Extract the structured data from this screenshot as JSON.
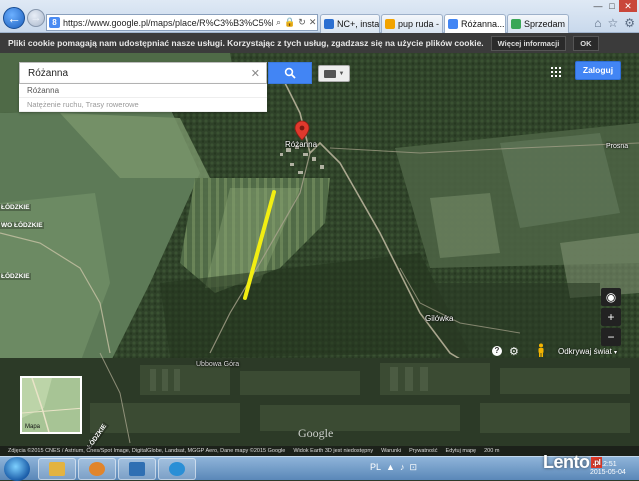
{
  "browser": {
    "address": "https://www.google.pl/maps/place/R%C3%B3%C5%BCanna/@5",
    "tabs": [
      {
        "label": "NC+, instal...",
        "icon_color": "#2c6fd1"
      },
      {
        "label": "pup ruda - ...",
        "icon_color": "#f2a300"
      },
      {
        "label": "Różanna...",
        "icon_color": "#4285f4"
      },
      {
        "label": "Sprzedam ...",
        "icon_color": "#3aa757"
      }
    ]
  },
  "cookie_bar": {
    "text": "Pliki cookie pomagają nam udostępniać nasze usługi. Korzystając z tych usług, zgadzasz się na użycie plików cookie.",
    "more_info": "Więcej informacji",
    "ok": "OK"
  },
  "search": {
    "value": "Różanna",
    "dropdown": [
      "Różanna",
      "Natężenie ruchu, Trasy rowerowe"
    ]
  },
  "header": {
    "signin": "Zaloguj"
  },
  "map": {
    "labels": {
      "town": "Różanna",
      "east": "Prosna",
      "village": "Gilówka",
      "south": "Ubbowa Góra",
      "road_left_1": "ŁÓDZKIE",
      "road_left_2": "WO ŁÓDZKIE",
      "road_left_3": "ŁÓDZKIE",
      "road_bottom": "ŁÓDZKIE"
    },
    "minimap_label": "Mapa",
    "google_logo": "Google",
    "explore_label": "Odkrywaj świat",
    "attribution": [
      "Zdjęcia ©2015 CNES / Astrium, Cnes/Spot Image, DigitalGlobe, Landsat, MGGP Aero, Dane mapy ©2015 Google",
      "Widok Earth 3D jest niedostępny",
      "Warunki",
      "Prywatność",
      "Edytuj mapę",
      "200 m"
    ]
  },
  "taskbar": {
    "apps": [
      {
        "icon_color": "#e3b341"
      },
      {
        "icon_color": "#e1852c"
      },
      {
        "icon_color": "#2f6fb3"
      },
      {
        "icon_color": "#2a8fd6"
      }
    ],
    "tray_icons": [
      "PL",
      "▲",
      "♪",
      "⊡"
    ],
    "clock_time": "12:51",
    "clock_date": "2015-05-04"
  },
  "watermark": {
    "text": "Lento",
    "suffix": ".pl"
  },
  "colors": {
    "accent": "#4285f4",
    "marker": "#e0392d",
    "track": "#f2ee12"
  }
}
